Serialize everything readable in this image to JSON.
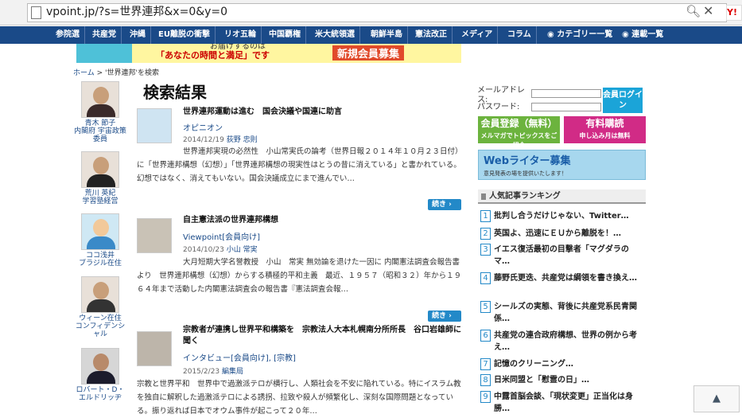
{
  "browser": {
    "url": "vpoint.jp/?s=世界連邦&x=0&y=0",
    "ext_label": "Y!"
  },
  "nav": {
    "items": [
      "参院選",
      "共産党",
      "沖縄",
      "EU離脱の衝撃",
      "リオ五輪",
      "中国覇権",
      "米大統領選",
      "朝鮮半島",
      "憲法改正",
      "メディア",
      "コラム",
      "カテゴリー一覧",
      "連載一覧"
    ]
  },
  "banner": {
    "line1": "お届けするのは",
    "line2": "「あなたの時間と満足」です",
    "line3": "新規会員募集"
  },
  "breadcrumb": {
    "home": "ホーム",
    "sep": ">",
    "current": "'世界連邦'を検索"
  },
  "people": [
    {
      "name": "青木 節子",
      "role": "内閣府 宇宙政策委員"
    },
    {
      "name": "荒川 英紀",
      "role": "学習塾経営"
    },
    {
      "name": "ココ浅井",
      "role": "ブラジル在住"
    },
    {
      "name": "ウィーン在住",
      "role": "コンフィデンシャル"
    },
    {
      "name": "ロバート・D・エルドリッヂ",
      "role": ""
    }
  ],
  "page_title": "検索結果",
  "results": [
    {
      "title": "世界連邦運動は進む　国会決議や国連に助言",
      "category": "オピニオン",
      "date": "2014/12/19",
      "author": "荻野 忠則",
      "excerpt": "世界連邦実現の必然性　小山常実氏の論考（世界日報２０１４年１０月２３日付）に「世界連邦構想（幻想）」「世界連邦構想の現実性はとうの昔に消えている」と書かれている。幻想ではなく、消えてもいない。国会決議成立にまで進んでい…",
      "more": "続き"
    },
    {
      "title": "自主憲法派の世界連邦構想",
      "category": "Viewpoint[会員向け]",
      "date": "2014/10/23",
      "author": "小山 常実",
      "excerpt": "大月短期大学名誉教授　小山　常実 無効論を退けた一因に 内閣憲法調査会報告書より　世界連邦構想（幻想）からする積極的平和主義　最近、１９５７（昭和３２）年から１９６４年まで活動した内閣憲法調査会の報告書『憲法調査会報…",
      "more": "続き"
    },
    {
      "title": "宗教者が連携し世界平和構築を　宗教法人大本札幌南分所所長　谷口岩雄師に聞く",
      "category": "インタビュー[会員向け], [宗教]",
      "date": "2015/2/23",
      "author": "編集局",
      "excerpt": "宗教と世界平和　世界中で過激派テロが横行し、人類社会を不安に陥れている。特にイスラム教を独自に解釈した過激派テロによる誘拐、拉致や殺人が頻繁化し、深刻な国際問題となっている。振り返れば日本でオウム事件が起こって２０年…",
      "more": ""
    }
  ],
  "login": {
    "email_label": "メールアドレス:",
    "password_label": "パスワード:",
    "button": "会員ログイン"
  },
  "promo": {
    "register_big": "会員登録（無料）",
    "register_small": "メルマガでトピックスをご紹介",
    "paid_big": "有料購読",
    "paid_small": "申し込み月は無料"
  },
  "writer": {
    "title": "Webライター募集",
    "sub": "意見発表の場を提供いたします！"
  },
  "ranking": {
    "title": "人気記事ランキング",
    "items": [
      "批判し合うだけじゃない、Twitter…",
      "英国よ、迅速にＥＵから離脱を！…",
      "イエス復活最初の目撃者「マグダラのマ…",
      "藤野氏更迭、共産党は綱領を書き換え…",
      "シールズの実態、背後に共産党系民青関係…",
      "共産党の連合政府構想、世界の例から考え…",
      "記憶のクリーニング…",
      "日米同盟と「慰霊の日」…",
      "中露首脳会談、「現状変更」正当化は身勝…"
    ]
  },
  "totop": "▲",
  "colors": {
    "nav_bg": "#1a4a88",
    "accent": "#2389c8",
    "register": "#6cb33e",
    "paid": "#d12b86"
  }
}
